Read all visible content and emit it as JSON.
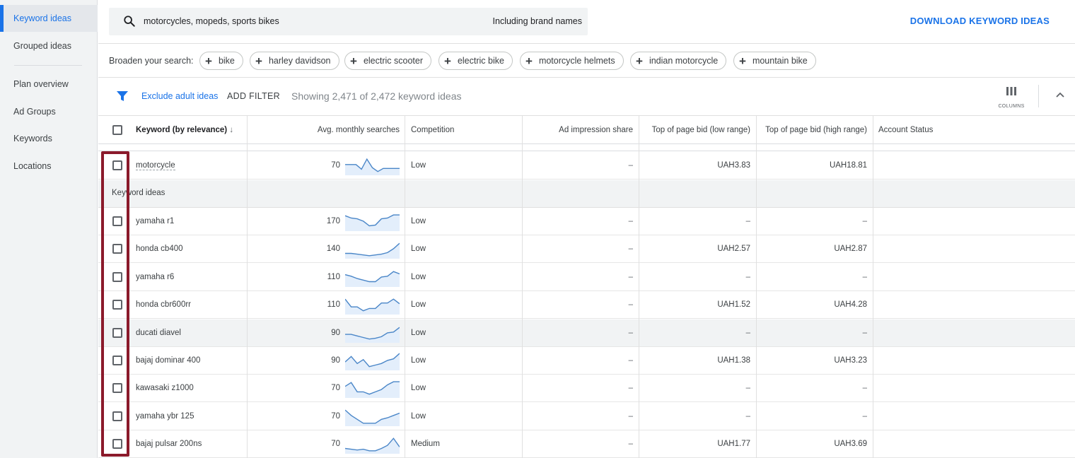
{
  "sidebar": {
    "items": [
      {
        "label": "Keyword ideas",
        "active": true
      },
      {
        "label": "Grouped ideas",
        "active": false
      },
      {
        "label": "Plan overview",
        "active": false
      },
      {
        "label": "Ad Groups",
        "active": false
      },
      {
        "label": "Keywords",
        "active": false
      },
      {
        "label": "Locations",
        "active": false
      }
    ]
  },
  "search": {
    "query": "motorcycles, mopeds, sports bikes",
    "brand_option": "Including brand names"
  },
  "download_label": "DOWNLOAD KEYWORD IDEAS",
  "broaden": {
    "label": "Broaden your search:",
    "chips": [
      "bike",
      "harley davidson",
      "electric scooter",
      "electric bike",
      "motorcycle helmets",
      "indian motorcycle",
      "mountain bike"
    ]
  },
  "filters": {
    "exclude_label": "Exclude adult ideas",
    "add_filter_label": "ADD FILTER",
    "showing_text": "Showing 2,471 of 2,472 keyword ideas",
    "columns_label": "COLUMNS"
  },
  "table": {
    "headers": {
      "keyword": "Keyword (by relevance)",
      "searches": "Avg. monthly searches",
      "competition": "Competition",
      "impression_share": "Ad impression share",
      "bid_low": "Top of page bid (low range)",
      "bid_high": "Top of page bid (high range)",
      "status": "Account Status"
    },
    "group_label": "Keyword ideas",
    "provided_row": {
      "keyword": "motorcycle",
      "searches": "70",
      "competition": "Low",
      "impression_share": "–",
      "bid_low": "UAH3.83",
      "bid_high": "UAH18.81",
      "trend": [
        60,
        60,
        60,
        30,
        95,
        40,
        15,
        35,
        35,
        35,
        35
      ]
    },
    "rows": [
      {
        "keyword": "yamaha r1",
        "searches": "170",
        "competition": "Low",
        "impression_share": "–",
        "bid_low": "–",
        "bid_high": "–",
        "trend": [
          90,
          75,
          70,
          55,
          25,
          30,
          70,
          75,
          95,
          95
        ]
      },
      {
        "keyword": "honda cb400",
        "searches": "140",
        "competition": "Low",
        "impression_share": "–",
        "bid_low": "UAH2.57",
        "bid_high": "UAH2.87",
        "trend": [
          25,
          25,
          20,
          15,
          10,
          15,
          20,
          30,
          55,
          90
        ]
      },
      {
        "keyword": "yamaha r6",
        "searches": "110",
        "competition": "Low",
        "impression_share": "–",
        "bid_low": "–",
        "bid_high": "–",
        "trend": [
          70,
          60,
          45,
          35,
          25,
          25,
          55,
          60,
          90,
          75
        ]
      },
      {
        "keyword": "honda cbr600rr",
        "searches": "110",
        "competition": "Low",
        "impression_share": "–",
        "bid_low": "UAH1.52",
        "bid_high": "UAH4.28",
        "trend": [
          90,
          40,
          40,
          15,
          30,
          30,
          65,
          65,
          90,
          60
        ]
      },
      {
        "keyword": "ducati diavel",
        "searches": "90",
        "competition": "Low",
        "impression_share": "–",
        "bid_low": "–",
        "bid_high": "–",
        "trend": [
          45,
          45,
          35,
          25,
          15,
          20,
          30,
          55,
          60,
          90
        ]
      },
      {
        "keyword": "bajaj dominar 400",
        "searches": "90",
        "competition": "Low",
        "impression_share": "–",
        "bid_low": "UAH1.38",
        "bid_high": "UAH3.23",
        "trend": [
          45,
          80,
          35,
          60,
          15,
          25,
          35,
          55,
          65,
          100
        ]
      },
      {
        "keyword": "kawasaki z1000",
        "searches": "70",
        "competition": "Low",
        "impression_share": "–",
        "bid_low": "–",
        "bid_high": "–",
        "trend": [
          65,
          90,
          30,
          30,
          15,
          30,
          45,
          75,
          95,
          95
        ]
      },
      {
        "keyword": "yamaha ybr 125",
        "searches": "70",
        "competition": "Low",
        "impression_share": "–",
        "bid_low": "–",
        "bid_high": "–",
        "trend": [
          95,
          60,
          35,
          10,
          10,
          10,
          35,
          45,
          60,
          75
        ]
      },
      {
        "keyword": "bajaj pulsar 200ns",
        "searches": "70",
        "competition": "Medium",
        "impression_share": "–",
        "bid_low": "UAH1.77",
        "bid_high": "UAH3.69",
        "trend": [
          25,
          20,
          15,
          20,
          10,
          10,
          25,
          45,
          90,
          35
        ]
      }
    ]
  },
  "colors": {
    "accent": "#1a73e8",
    "highlight": "#8b1a2b",
    "sparkline": "#4a86c8",
    "sparkfill": "#e3eefb"
  }
}
